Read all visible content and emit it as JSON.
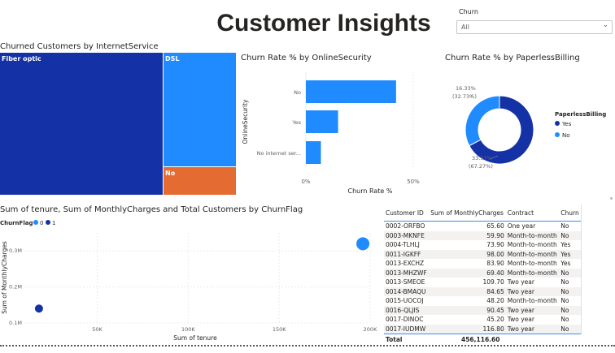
{
  "page": {
    "title": "Customer Insights"
  },
  "slicer": {
    "label": "Churn",
    "value": "All"
  },
  "treemap": {
    "title": "Churned Customers by InternetService",
    "items": [
      {
        "label": "Fiber optic",
        "color": "#1432a6"
      },
      {
        "label": "DSL",
        "color": "#1f8bff"
      },
      {
        "label": "No",
        "color": "#e46c32"
      }
    ]
  },
  "online_security": {
    "title": "Churn Rate % by OnlineSecurity",
    "ylabel": "OnlineSecurity",
    "xlabel": "Churn Rate %",
    "ticks": [
      "0%",
      "50%"
    ],
    "categories": [
      "No",
      "Yes",
      "No internet ser..."
    ],
    "values": [
      0.42,
      0.15,
      0.07
    ],
    "color": "#1f8bff"
  },
  "paperless": {
    "title": "Churn Rate % by PaperlessBilling",
    "legend_title": "PaperlessBilling",
    "legend": [
      {
        "label": "Yes",
        "color": "#1432a6"
      },
      {
        "label": "No",
        "color": "#1f8bff"
      }
    ],
    "label_no": {
      "value": "16.33%",
      "share": "(32.73%)"
    },
    "label_yes": {
      "value": "33.57%",
      "share": "(67.27%)"
    }
  },
  "scatter": {
    "title": "Sum of tenure, Sum of MonthlyCharges and Total Customers by ChurnFlag",
    "legend_title": "ChurnFlag",
    "legend": [
      {
        "label": "0",
        "color": "#1f8bff"
      },
      {
        "label": "1",
        "color": "#1432a6"
      }
    ],
    "xlabel": "Sum of tenure",
    "ylabel": "Sum of MonthlyCharges",
    "xticks": [
      "50K",
      "100K",
      "150K",
      "200K"
    ],
    "yticks": [
      "0.1M",
      "0.2M",
      "0.3M"
    ]
  },
  "table": {
    "headers": [
      "Customer ID",
      "Sum of MonthlyCharges",
      "Contract",
      "Churn"
    ],
    "rows": [
      [
        "0002-ORFBO",
        "65.60",
        "One year",
        "No"
      ],
      [
        "0003-MKNFE",
        "59.90",
        "Month-to-month",
        "No"
      ],
      [
        "0004-TLHLJ",
        "73.90",
        "Month-to-month",
        "Yes"
      ],
      [
        "0011-IGKFF",
        "98.00",
        "Month-to-month",
        "Yes"
      ],
      [
        "0013-EXCHZ",
        "83.90",
        "Month-to-month",
        "Yes"
      ],
      [
        "0013-MHZWF",
        "69.40",
        "Month-to-month",
        "No"
      ],
      [
        "0013-SMEOE",
        "109.70",
        "Two year",
        "No"
      ],
      [
        "0014-BMAQU",
        "84.65",
        "Two year",
        "No"
      ],
      [
        "0015-UOCOJ",
        "48.20",
        "Month-to-month",
        "No"
      ],
      [
        "0016-QLJIS",
        "90.45",
        "Two year",
        "No"
      ],
      [
        "0017-DINOC",
        "45.20",
        "Two year",
        "No"
      ],
      [
        "0017-IUDMW",
        "116.80",
        "Two year",
        "No"
      ]
    ],
    "total_label": "Total",
    "total_value": "456,116.60"
  },
  "chart_data": [
    {
      "type": "bar",
      "title": "Churn Rate % by OnlineSecurity",
      "categories": [
        "No",
        "Yes",
        "No internet ser..."
      ],
      "values": [
        42,
        15,
        7
      ],
      "xlabel": "Churn Rate %",
      "ylabel": "OnlineSecurity",
      "xlim": [
        0,
        50
      ]
    },
    {
      "type": "pie",
      "title": "Churn Rate % by PaperlessBilling",
      "categories": [
        "Yes",
        "No"
      ],
      "values": [
        33.57,
        16.33
      ],
      "shares": [
        67.27,
        32.73
      ]
    },
    {
      "type": "scatter",
      "title": "Sum of tenure, Sum of MonthlyCharges and Total Customers by ChurnFlag",
      "xlabel": "Sum of tenure",
      "ylabel": "Sum of MonthlyCharges",
      "series": [
        {
          "name": "0",
          "x": [
            196000
          ],
          "y": [
            0.32
          ]
        },
        {
          "name": "1",
          "x": [
            18000
          ],
          "y": [
            0.14
          ]
        }
      ],
      "xlim": [
        10000,
        200000
      ],
      "ylim": [
        0.1,
        0.35
      ]
    }
  ]
}
